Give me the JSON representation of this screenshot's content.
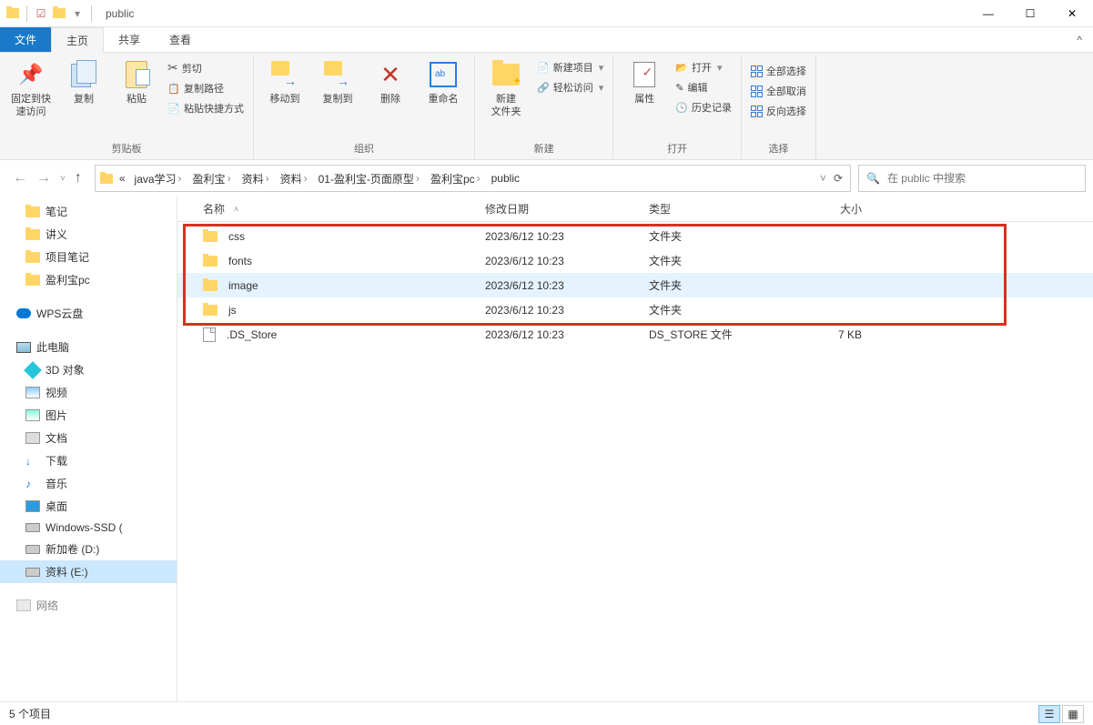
{
  "title": "public",
  "ribbon": {
    "tabs": {
      "file": "文件",
      "home": "主页",
      "share": "共享",
      "view": "查看"
    },
    "groups": {
      "clipboard": {
        "label": "剪贴板",
        "pin": "固定到快\n速访问",
        "copy": "复制",
        "paste": "粘贴",
        "cut": "剪切",
        "copypath": "复制路径",
        "pasteshortcut": "粘贴快捷方式"
      },
      "organize": {
        "label": "组织",
        "moveto": "移动到",
        "copyto": "复制到",
        "delete": "删除",
        "rename": "重命名"
      },
      "new": {
        "label": "新建",
        "newfolder": "新建\n文件夹",
        "newitem": "新建项目",
        "easyaccess": "轻松访问"
      },
      "open": {
        "label": "打开",
        "properties": "属性",
        "open": "打开",
        "edit": "编辑",
        "history": "历史记录"
      },
      "select": {
        "label": "选择",
        "selectall": "全部选择",
        "selectnone": "全部取消",
        "invert": "反向选择"
      }
    }
  },
  "breadcrumb": {
    "prefix": "«",
    "segments": [
      "java学习",
      "盈利宝",
      "资料",
      "资料",
      "01-盈利宝-页面原型",
      "盈利宝pc",
      "public"
    ]
  },
  "search": {
    "placeholder": "在 public 中搜索"
  },
  "sidebar": {
    "quick": [
      {
        "label": "笔记",
        "icon": "folder"
      },
      {
        "label": "讲义",
        "icon": "folder"
      },
      {
        "label": "项目笔记",
        "icon": "folder"
      },
      {
        "label": "盈利宝pc",
        "icon": "folder"
      }
    ],
    "wps": "WPS云盘",
    "thispc": "此电脑",
    "pcitems": [
      {
        "label": "3D 对象",
        "icon": "obj3d"
      },
      {
        "label": "视频",
        "icon": "generic"
      },
      {
        "label": "图片",
        "icon": "generic"
      },
      {
        "label": "文档",
        "icon": "generic"
      },
      {
        "label": "下载",
        "icon": "generic"
      },
      {
        "label": "音乐",
        "icon": "generic"
      },
      {
        "label": "桌面",
        "icon": "generic"
      },
      {
        "label": "Windows-SSD (",
        "icon": "drive"
      },
      {
        "label": "新加卷 (D:)",
        "icon": "drive"
      },
      {
        "label": "资料 (E:)",
        "icon": "drive",
        "selected": true
      }
    ],
    "networkPartial": "网络"
  },
  "columns": {
    "name": "名称",
    "date": "修改日期",
    "type": "类型",
    "size": "大小"
  },
  "files": [
    {
      "name": "css",
      "date": "2023/6/12 10:23",
      "type": "文件夹",
      "size": "",
      "icon": "folder"
    },
    {
      "name": "fonts",
      "date": "2023/6/12 10:23",
      "type": "文件夹",
      "size": "",
      "icon": "folder"
    },
    {
      "name": "image",
      "date": "2023/6/12 10:23",
      "type": "文件夹",
      "size": "",
      "icon": "folder",
      "highlight": true
    },
    {
      "name": "js",
      "date": "2023/6/12 10:23",
      "type": "文件夹",
      "size": "",
      "icon": "folder"
    },
    {
      "name": ".DS_Store",
      "date": "2023/6/12 10:23",
      "type": "DS_STORE 文件",
      "size": "7 KB",
      "icon": "file"
    }
  ],
  "status": {
    "count": "5 个项目"
  }
}
